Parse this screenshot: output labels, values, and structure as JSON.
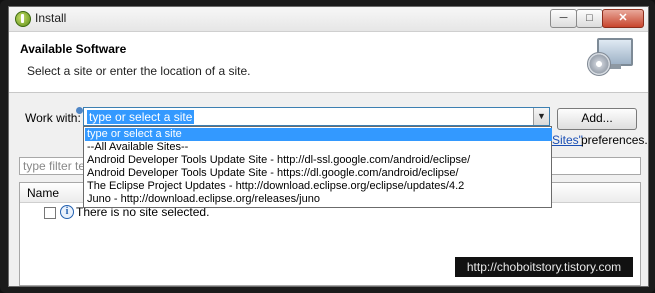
{
  "window": {
    "title": "Install",
    "min_label": "─",
    "max_label": "□",
    "close_label": "✕"
  },
  "header": {
    "title": "Available Software",
    "description": "Select a site or enter the location of a site.",
    "icon": "monitor-with-disc-icon"
  },
  "work_with": {
    "label": "Work with:",
    "value": "type or select a site",
    "add_label": "Add...",
    "sites_link": "Sites\"",
    "preferences_text": "preferences."
  },
  "dropdown": {
    "items": [
      "type or select a site",
      "--All Available Sites--",
      "Android Developer Tools Update Site - http://dl-ssl.google.com/android/eclipse/",
      "Android Developer Tools Update Site - https://dl.google.com/android/eclipse/",
      "The Eclipse Project Updates - http://download.eclipse.org/eclipse/updates/4.2",
      "Juno - http://download.eclipse.org/releases/juno"
    ],
    "selected_index": 0
  },
  "filter": {
    "placeholder": "type filter te"
  },
  "table": {
    "columns": [
      "Name"
    ],
    "rows": [
      {
        "text": "There is no site selected."
      }
    ]
  },
  "watermark": "http://choboitstory.tistory.com",
  "colors": {
    "selection": "#3399ff",
    "link": "#1a4fb5"
  }
}
